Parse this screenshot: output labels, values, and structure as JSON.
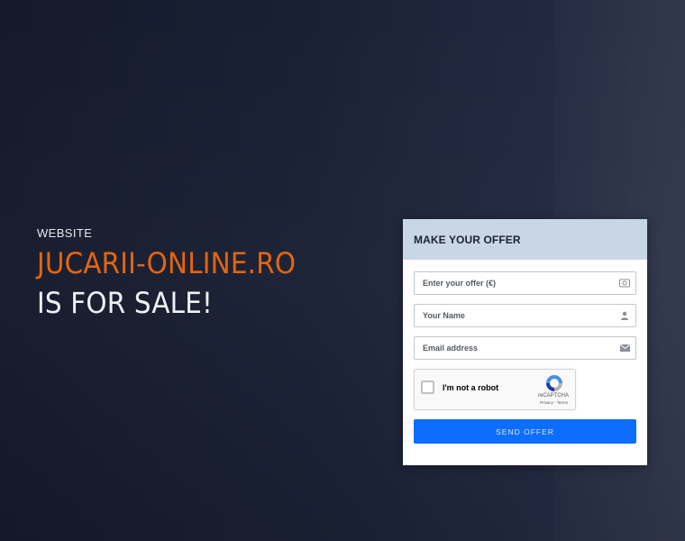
{
  "hero": {
    "label": "WEBSITE",
    "domain": "JUCARII-ONLINE.RO",
    "sale_text": "IS FOR SALE!"
  },
  "offer_form": {
    "title": "MAKE YOUR OFFER",
    "offer_placeholder": "Enter your offer (€)",
    "name_placeholder": "Your Name",
    "email_placeholder": "Email address",
    "captcha_label": "I'm not a robot",
    "captcha_brand": "reCAPTCHA",
    "captcha_links": "Privacy - Terms",
    "submit_label": "SEND OFFER",
    "icons": {
      "offer": "money-icon",
      "name": "user-icon",
      "email": "envelope-icon",
      "captcha": "recaptcha-icon"
    }
  },
  "colors": {
    "accent": "#e4650f",
    "button": "#0d6efd",
    "header": "#c9d6e6"
  }
}
